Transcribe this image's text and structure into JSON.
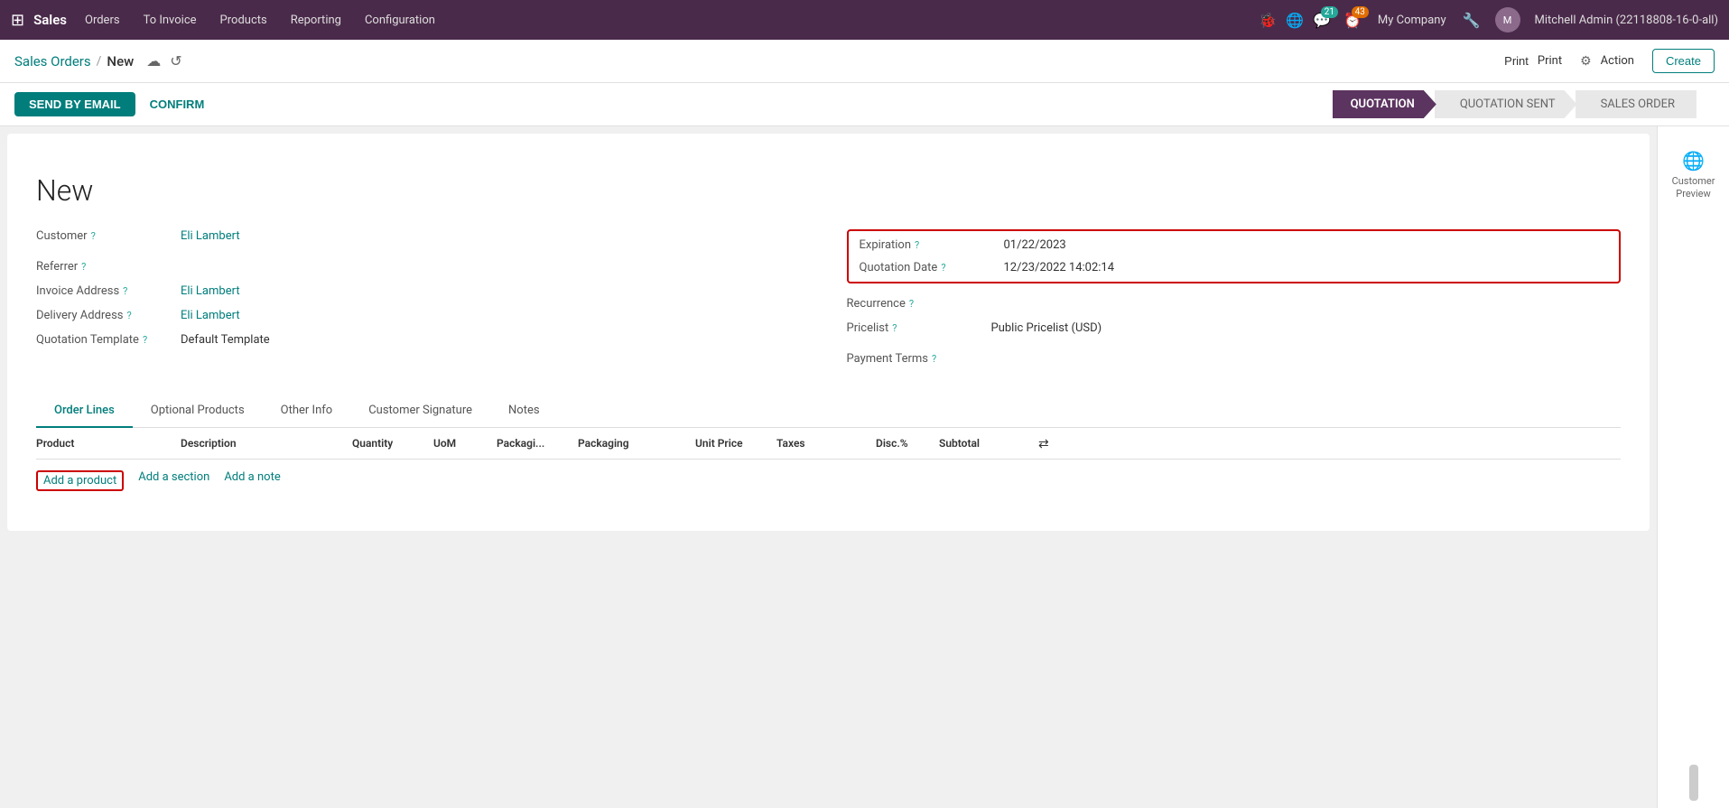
{
  "topNav": {
    "appIcon": "⊞",
    "brand": "Sales",
    "items": [
      "Orders",
      "To Invoice",
      "Products",
      "Reporting",
      "Configuration"
    ],
    "chatBadge": "21",
    "clockBadge": "43",
    "company": "My Company",
    "user": "Mitchell Admin (22118808-16-0-all)"
  },
  "breadcrumb": {
    "parent": "Sales Orders",
    "separator": "/",
    "current": "New",
    "saveIcon": "☁",
    "resetIcon": "↺"
  },
  "barActions": {
    "printLabel": "Print",
    "actionLabel": "Action",
    "createLabel": "Create"
  },
  "actionBar": {
    "sendByEmail": "SEND BY EMAIL",
    "confirm": "CONFIRM"
  },
  "statusBar": {
    "steps": [
      "QUOTATION",
      "QUOTATION SENT",
      "SALES ORDER"
    ]
  },
  "sidebar": {
    "icon": "🌐",
    "label1": "Customer",
    "label2": "Preview"
  },
  "form": {
    "title": "New",
    "leftFields": [
      {
        "label": "Customer",
        "value": "Eli Lambert",
        "hasHelp": true,
        "isLink": true
      },
      {
        "label": "Referrer",
        "value": "",
        "hasHelp": true,
        "isLink": false
      },
      {
        "label": "Invoice Address",
        "value": "Eli Lambert",
        "hasHelp": true,
        "isLink": true
      },
      {
        "label": "Delivery Address",
        "value": "Eli Lambert",
        "hasHelp": true,
        "isLink": true
      },
      {
        "label": "Quotation Template",
        "value": "Default Template",
        "hasHelp": true,
        "isLink": false
      }
    ],
    "rightFields": [
      {
        "label": "Expiration",
        "value": "01/22/2023",
        "hasHelp": true,
        "highlighted": true
      },
      {
        "label": "Quotation Date",
        "value": "12/23/2022 14:02:14",
        "hasHelp": true,
        "highlighted": true
      },
      {
        "label": "Recurrence",
        "value": "",
        "hasHelp": true,
        "highlighted": false
      },
      {
        "label": "Pricelist",
        "value": "Public Pricelist (USD)",
        "hasHelp": true,
        "highlighted": false
      },
      {
        "label": "Payment Terms",
        "value": "",
        "hasHelp": true,
        "highlighted": false
      }
    ]
  },
  "tabs": {
    "items": [
      "Order Lines",
      "Optional Products",
      "Other Info",
      "Customer Signature",
      "Notes"
    ],
    "active": "Order Lines"
  },
  "orderTable": {
    "columns": [
      "Product",
      "Description",
      "Quantity",
      "UoM",
      "Packagi...",
      "Packaging",
      "Unit Price",
      "Taxes",
      "Disc.%",
      "Subtotal",
      "⇄"
    ],
    "addProduct": "Add a product",
    "addSection": "Add a section",
    "addNote": "Add a note"
  },
  "helpText": "?"
}
